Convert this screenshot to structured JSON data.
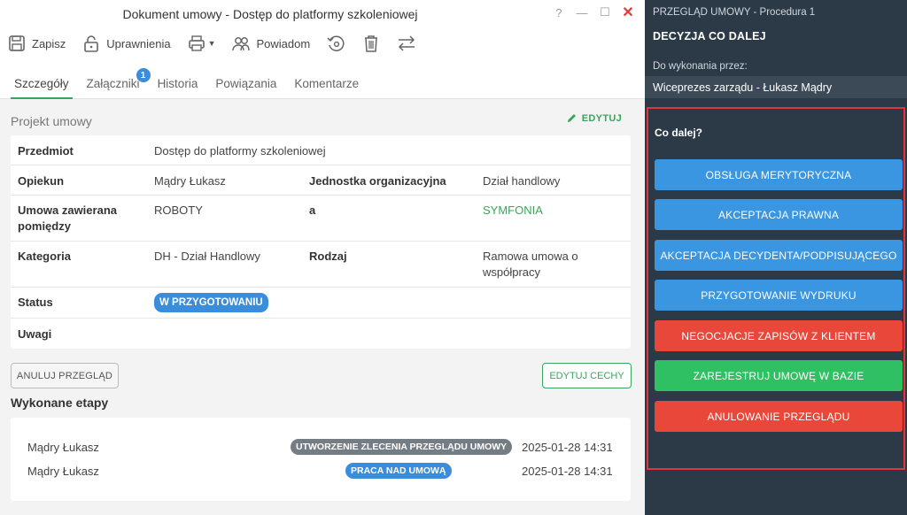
{
  "window": {
    "title": "Dokument umowy - Dostęp do platformy szkoleniowej",
    "help": "?",
    "minimize": "—",
    "maximize": "☐",
    "close": "✕"
  },
  "toolbar": {
    "save": "Zapisz",
    "permissions": "Uprawnienia",
    "notify": "Powiadom"
  },
  "tabs": [
    {
      "label": "Szczegóły",
      "active": true
    },
    {
      "label": "Załączniki",
      "badge": "1"
    },
    {
      "label": "Historia"
    },
    {
      "label": "Powiązania"
    },
    {
      "label": "Komentarze"
    }
  ],
  "details": {
    "section_label": "Projekt umowy",
    "edit": "EDYTUJ",
    "subject_label": "Przedmiot",
    "subject_value": "Dostęp do platformy szkoleniowej",
    "guardian_label": "Opiekun",
    "guardian_value": "Mądry Łukasz",
    "unit_label": "Jednostka organizacyjna",
    "unit_value": "Dział handlowy",
    "parties_label": "Umowa zawierana pomiędzy",
    "party_a": "ROBOTY",
    "and": "a",
    "party_b": "SYMFONIA",
    "category_label": "Kategoria",
    "category_value": "DH - Dział Handlowy",
    "kind_label": "Rodzaj",
    "kind_value": "Ramowa umowa o współpracy",
    "status_label": "Status",
    "status_value": "W PRZYGOTOWANIU",
    "notes_label": "Uwagi"
  },
  "actions": {
    "cancel_review": "ANULUJ PRZEGLĄD",
    "edit_features": "EDYTUJ CECHY"
  },
  "stages": {
    "title": "Wykonane etapy",
    "items": [
      {
        "who": "Mądry Łukasz",
        "stage": "UTWORZENIE ZLECENIA PRZEGLĄDU UMOWY",
        "color": "#757d84",
        "time": "2025-01-28 14:31"
      },
      {
        "who": "Mądry Łukasz",
        "stage": "PRACA NAD UMOWĄ",
        "color": "#3a8ddb",
        "time": "2025-01-28 14:31"
      }
    ]
  },
  "side": {
    "procedure": "PRZEGLĄD UMOWY - Procedura 1",
    "decision": "DECYZJA CO DALEJ",
    "todo_label": "Do wykonania przez:",
    "assignee": "Wiceprezes zarządu - Łukasz Mądry",
    "question": "Co dalej?",
    "buttons": [
      {
        "label": "OBSŁUGA MERYTORYCZNA",
        "color": "#3a96e0"
      },
      {
        "label": "AKCEPTACJA PRAWNA",
        "color": "#3a96e0"
      },
      {
        "label": "AKCEPTACJA DECYDENTA/PODPISUJĄCEGO",
        "color": "#3a96e0"
      },
      {
        "label": "PRZYGOTOWANIE WYDRUKU",
        "color": "#3a96e0"
      },
      {
        "label": "NEGOCJACJE ZAPISÓW Z KLIENTEM",
        "color": "#e8473a"
      },
      {
        "label": "ZAREJESTRUJ UMOWĘ W BAZIE",
        "color": "#2fc063"
      },
      {
        "label": "ANULOWANIE PRZEGLĄDU",
        "color": "#e8473a"
      }
    ]
  },
  "colors": {
    "accent_green": "#3aa55a",
    "accent_blue": "#3a8ddb",
    "panel_dark": "#2c3a48",
    "highlight_red": "#e0353a"
  }
}
